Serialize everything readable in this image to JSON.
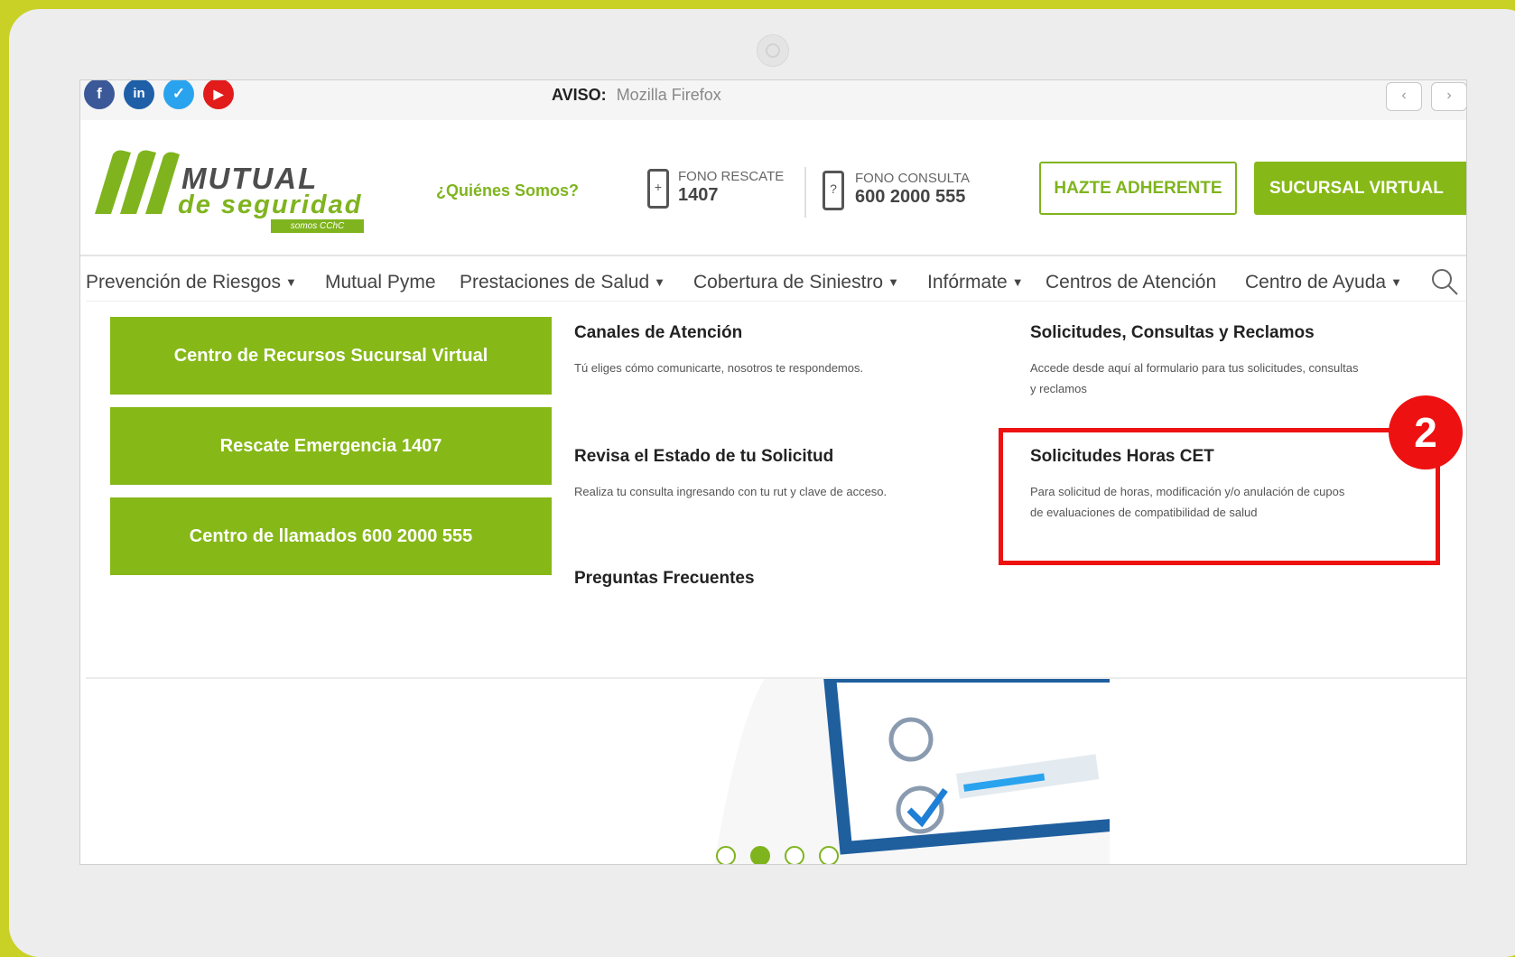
{
  "topbar": {
    "social": [
      {
        "name": "facebook",
        "glyph": "f",
        "color": "#3b5998"
      },
      {
        "name": "linkedin",
        "glyph": "in",
        "color": "#1e5fa8"
      },
      {
        "name": "twitter",
        "glyph": "✓",
        "color": "#2aa3ef"
      },
      {
        "name": "youtube",
        "glyph": "▶",
        "color": "#e21b1b"
      }
    ],
    "aviso_label": "AVISO:",
    "aviso_value": "Mozilla Firefox",
    "prev": "‹",
    "next": "›"
  },
  "header": {
    "logo_line1": "MUTUAL",
    "logo_line2": "de seguridad",
    "logo_tag": "somos CChC",
    "quienes": "¿Quiénes Somos?",
    "fono_rescate_label": "FONO RESCATE",
    "fono_rescate_num": "1407",
    "fono_consulta_label": "FONO CONSULTA",
    "fono_consulta_num": "600 2000 555",
    "btn_adherente": "HAZTE ADHERENTE",
    "btn_sucursal": "SUCURSAL VIRTUAL"
  },
  "nav": {
    "items": [
      {
        "label": "Prevención de Riesgos",
        "caret": "▼"
      },
      {
        "label": "Mutual Pyme",
        "caret": ""
      },
      {
        "label": "Prestaciones de Salud",
        "caret": "▼"
      },
      {
        "label": "Cobertura de Siniestro",
        "caret": "▼"
      },
      {
        "label": "Infórmate",
        "caret": "▼"
      },
      {
        "label": "Centros de Atención",
        "caret": ""
      },
      {
        "label": "Centro de Ayuda",
        "caret": "▼"
      }
    ]
  },
  "dropdown": {
    "buttons": [
      "Centro de Recursos Sucursal Virtual",
      "Rescate Emergencia 1407",
      "Centro de llamados 600 2000 555"
    ],
    "links": [
      {
        "title": "Canales de Atención",
        "desc": "Tú eliges cómo comunicarte, nosotros te respondemos."
      },
      {
        "title": "Revisa el Estado de tu Solicitud",
        "desc": "Realiza tu consulta ingresando con tu rut y clave de acceso."
      },
      {
        "title": "Preguntas Frecuentes",
        "desc": ""
      },
      {
        "title": "Solicitudes, Consultas y Reclamos",
        "desc_line1": "Accede desde aquí al formulario para tus solicitudes, consultas",
        "desc_line2": "y reclamos"
      },
      {
        "title": "Solicitudes Horas CET",
        "desc_line1": "Para solicitud de horas, modificación y/o anulación de cupos",
        "desc_line2": "de evaluaciones de compatibilidad de salud"
      }
    ]
  },
  "annotation": {
    "step": "2",
    "color": "#ee1111"
  },
  "carousel": {
    "slides": 4,
    "active_index": 1
  },
  "colors": {
    "brand_green": "#86b817",
    "frame": "#c9d126"
  }
}
